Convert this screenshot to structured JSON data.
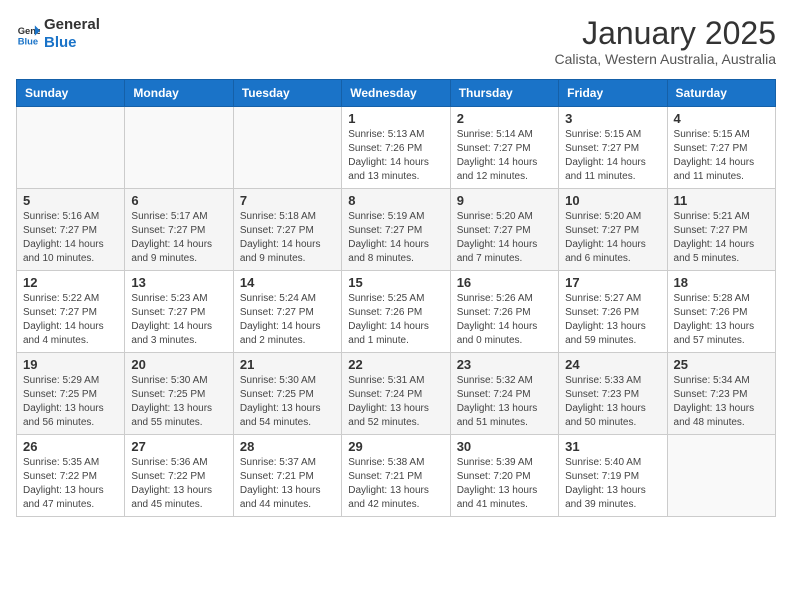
{
  "header": {
    "logo_general": "General",
    "logo_blue": "Blue",
    "month": "January 2025",
    "location": "Calista, Western Australia, Australia"
  },
  "days_of_week": [
    "Sunday",
    "Monday",
    "Tuesday",
    "Wednesday",
    "Thursday",
    "Friday",
    "Saturday"
  ],
  "weeks": [
    {
      "shade": false,
      "days": [
        {
          "num": "",
          "info": ""
        },
        {
          "num": "",
          "info": ""
        },
        {
          "num": "",
          "info": ""
        },
        {
          "num": "1",
          "info": "Sunrise: 5:13 AM\nSunset: 7:26 PM\nDaylight: 14 hours\nand 13 minutes."
        },
        {
          "num": "2",
          "info": "Sunrise: 5:14 AM\nSunset: 7:27 PM\nDaylight: 14 hours\nand 12 minutes."
        },
        {
          "num": "3",
          "info": "Sunrise: 5:15 AM\nSunset: 7:27 PM\nDaylight: 14 hours\nand 11 minutes."
        },
        {
          "num": "4",
          "info": "Sunrise: 5:15 AM\nSunset: 7:27 PM\nDaylight: 14 hours\nand 11 minutes."
        }
      ]
    },
    {
      "shade": true,
      "days": [
        {
          "num": "5",
          "info": "Sunrise: 5:16 AM\nSunset: 7:27 PM\nDaylight: 14 hours\nand 10 minutes."
        },
        {
          "num": "6",
          "info": "Sunrise: 5:17 AM\nSunset: 7:27 PM\nDaylight: 14 hours\nand 9 minutes."
        },
        {
          "num": "7",
          "info": "Sunrise: 5:18 AM\nSunset: 7:27 PM\nDaylight: 14 hours\nand 9 minutes."
        },
        {
          "num": "8",
          "info": "Sunrise: 5:19 AM\nSunset: 7:27 PM\nDaylight: 14 hours\nand 8 minutes."
        },
        {
          "num": "9",
          "info": "Sunrise: 5:20 AM\nSunset: 7:27 PM\nDaylight: 14 hours\nand 7 minutes."
        },
        {
          "num": "10",
          "info": "Sunrise: 5:20 AM\nSunset: 7:27 PM\nDaylight: 14 hours\nand 6 minutes."
        },
        {
          "num": "11",
          "info": "Sunrise: 5:21 AM\nSunset: 7:27 PM\nDaylight: 14 hours\nand 5 minutes."
        }
      ]
    },
    {
      "shade": false,
      "days": [
        {
          "num": "12",
          "info": "Sunrise: 5:22 AM\nSunset: 7:27 PM\nDaylight: 14 hours\nand 4 minutes."
        },
        {
          "num": "13",
          "info": "Sunrise: 5:23 AM\nSunset: 7:27 PM\nDaylight: 14 hours\nand 3 minutes."
        },
        {
          "num": "14",
          "info": "Sunrise: 5:24 AM\nSunset: 7:27 PM\nDaylight: 14 hours\nand 2 minutes."
        },
        {
          "num": "15",
          "info": "Sunrise: 5:25 AM\nSunset: 7:26 PM\nDaylight: 14 hours\nand 1 minute."
        },
        {
          "num": "16",
          "info": "Sunrise: 5:26 AM\nSunset: 7:26 PM\nDaylight: 14 hours\nand 0 minutes."
        },
        {
          "num": "17",
          "info": "Sunrise: 5:27 AM\nSunset: 7:26 PM\nDaylight: 13 hours\nand 59 minutes."
        },
        {
          "num": "18",
          "info": "Sunrise: 5:28 AM\nSunset: 7:26 PM\nDaylight: 13 hours\nand 57 minutes."
        }
      ]
    },
    {
      "shade": true,
      "days": [
        {
          "num": "19",
          "info": "Sunrise: 5:29 AM\nSunset: 7:25 PM\nDaylight: 13 hours\nand 56 minutes."
        },
        {
          "num": "20",
          "info": "Sunrise: 5:30 AM\nSunset: 7:25 PM\nDaylight: 13 hours\nand 55 minutes."
        },
        {
          "num": "21",
          "info": "Sunrise: 5:30 AM\nSunset: 7:25 PM\nDaylight: 13 hours\nand 54 minutes."
        },
        {
          "num": "22",
          "info": "Sunrise: 5:31 AM\nSunset: 7:24 PM\nDaylight: 13 hours\nand 52 minutes."
        },
        {
          "num": "23",
          "info": "Sunrise: 5:32 AM\nSunset: 7:24 PM\nDaylight: 13 hours\nand 51 minutes."
        },
        {
          "num": "24",
          "info": "Sunrise: 5:33 AM\nSunset: 7:23 PM\nDaylight: 13 hours\nand 50 minutes."
        },
        {
          "num": "25",
          "info": "Sunrise: 5:34 AM\nSunset: 7:23 PM\nDaylight: 13 hours\nand 48 minutes."
        }
      ]
    },
    {
      "shade": false,
      "days": [
        {
          "num": "26",
          "info": "Sunrise: 5:35 AM\nSunset: 7:22 PM\nDaylight: 13 hours\nand 47 minutes."
        },
        {
          "num": "27",
          "info": "Sunrise: 5:36 AM\nSunset: 7:22 PM\nDaylight: 13 hours\nand 45 minutes."
        },
        {
          "num": "28",
          "info": "Sunrise: 5:37 AM\nSunset: 7:21 PM\nDaylight: 13 hours\nand 44 minutes."
        },
        {
          "num": "29",
          "info": "Sunrise: 5:38 AM\nSunset: 7:21 PM\nDaylight: 13 hours\nand 42 minutes."
        },
        {
          "num": "30",
          "info": "Sunrise: 5:39 AM\nSunset: 7:20 PM\nDaylight: 13 hours\nand 41 minutes."
        },
        {
          "num": "31",
          "info": "Sunrise: 5:40 AM\nSunset: 7:19 PM\nDaylight: 13 hours\nand 39 minutes."
        },
        {
          "num": "",
          "info": ""
        }
      ]
    }
  ]
}
